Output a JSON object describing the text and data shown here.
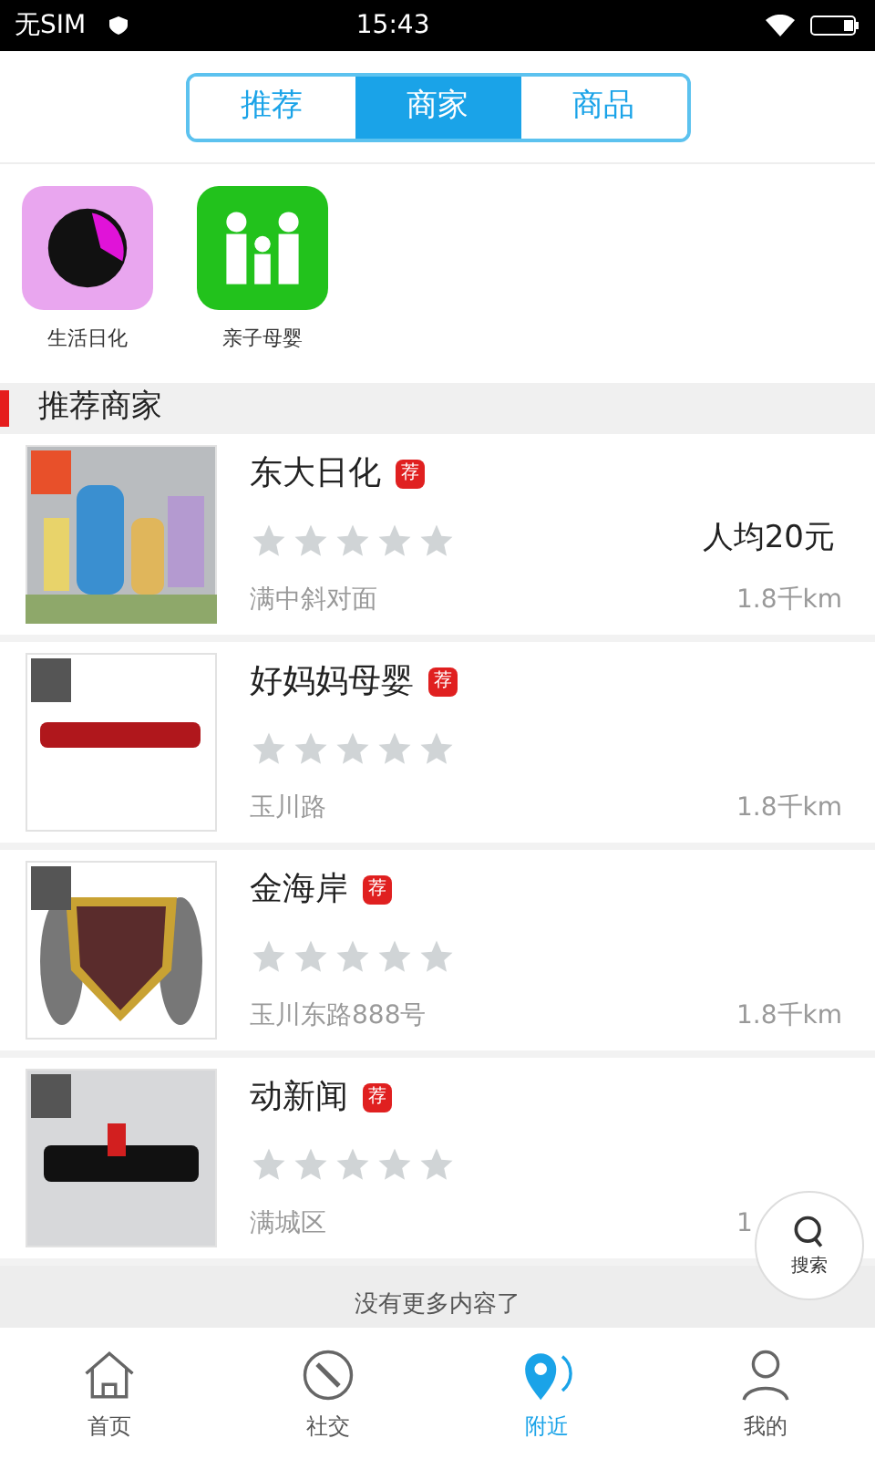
{
  "status_bar": {
    "carrier": "无SIM",
    "time": "15:43"
  },
  "tabs": [
    {
      "label": "推荐",
      "selected": false
    },
    {
      "label": "商家",
      "selected": true
    },
    {
      "label": "商品",
      "selected": false
    }
  ],
  "categories": [
    {
      "label": "生活日化",
      "color": "#e9a6ef"
    },
    {
      "label": "亲子母婴",
      "color": "#22c21c"
    }
  ],
  "section_title": "推荐商家",
  "merchants": [
    {
      "name": "东大日化",
      "badge": "荐",
      "stars": 0,
      "price": "人均20元",
      "address": "满中斜对面",
      "distance": "1.8千km"
    },
    {
      "name": "好妈妈母婴",
      "badge": "荐",
      "stars": 0,
      "address": "玉川路",
      "distance": "1.8千km"
    },
    {
      "name": "金海岸",
      "badge": "荐",
      "stars": 0,
      "address": "玉川东路888号",
      "distance": "1.8千km"
    },
    {
      "name": "动新闻",
      "badge": "荐",
      "stars": 0,
      "address": "满城区",
      "distance": "1"
    }
  ],
  "floating_search": {
    "label": "搜索"
  },
  "footer_text": "没有更多内容了",
  "nav": [
    {
      "label": "首页",
      "selected": false
    },
    {
      "label": "社交",
      "selected": false
    },
    {
      "label": "附近",
      "selected": true
    },
    {
      "label": "我的",
      "selected": false
    }
  ]
}
